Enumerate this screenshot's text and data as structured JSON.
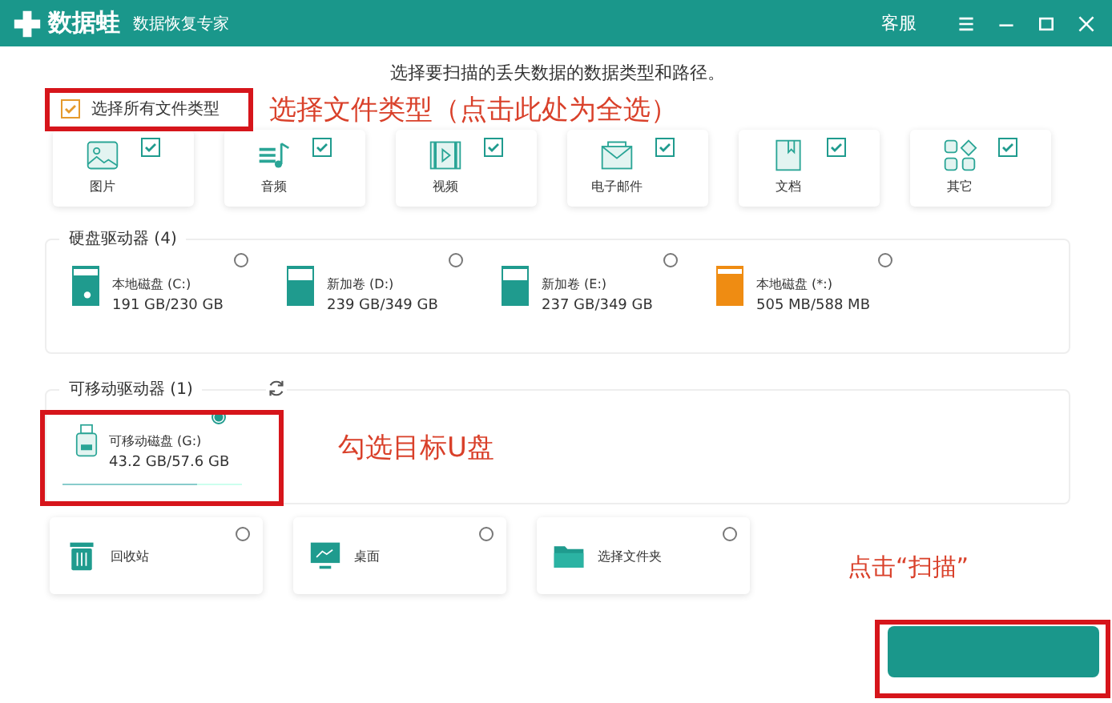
{
  "title_bar": {
    "logo_text": "数据蛙",
    "subtitle": "数据恢复专家",
    "service": "客服"
  },
  "instruction": "选择要扫描的丢失数据的数据类型和路径。",
  "select_all": {
    "label": "选择所有文件类型",
    "checked": true
  },
  "file_types": [
    {
      "kind": "image",
      "label": "图片",
      "checked": true
    },
    {
      "kind": "audio",
      "label": "音频",
      "checked": true
    },
    {
      "kind": "video",
      "label": "视频",
      "checked": true
    },
    {
      "kind": "email",
      "label": "电子邮件",
      "checked": true
    },
    {
      "kind": "document",
      "label": "文档",
      "checked": true
    },
    {
      "kind": "other",
      "label": "其它",
      "checked": true
    }
  ],
  "hard_drives": {
    "label": "硬盘驱动器 (4)",
    "drives": [
      {
        "name": "本地磁盘 (C:)",
        "size": "191 GB/230 GB",
        "level": 0.83,
        "color": "#1f9b8e",
        "system": true,
        "selected": false
      },
      {
        "name": "新加卷 (D:)",
        "size": "239 GB/349 GB",
        "level": 0.68,
        "color": "#1f9b8e",
        "system": false,
        "selected": false
      },
      {
        "name": "新加卷 (E:)",
        "size": "237 GB/349 GB",
        "level": 0.68,
        "color": "#1f9b8e",
        "system": false,
        "selected": false
      },
      {
        "name": "本地磁盘 (*:)",
        "size": "505 MB/588 MB",
        "level": 0.86,
        "color": "#ef8c12",
        "system": false,
        "selected": false
      }
    ]
  },
  "removable_drives": {
    "label": "可移动驱动器 (1)",
    "drives": [
      {
        "name": "可移动磁盘 (G:)",
        "size": "43.2 GB/57.6 GB",
        "level": 0.75,
        "selected": true
      }
    ]
  },
  "locations": [
    {
      "kind": "recycle",
      "label": "回收站",
      "selected": false
    },
    {
      "kind": "desktop",
      "label": "桌面",
      "selected": false
    },
    {
      "kind": "folder",
      "label": "选择文件夹",
      "selected": false
    }
  ],
  "annotations": [
    {
      "text": "选择文件类型（点击此处为全选）"
    },
    {
      "text": "勾选目标U盘"
    },
    {
      "text": "点击“扫描”"
    }
  ]
}
